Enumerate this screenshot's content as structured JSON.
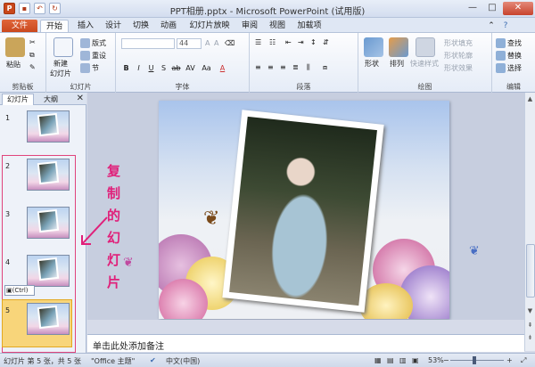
{
  "window": {
    "title": "PPT相册.pptx - Microsoft PowerPoint (试用版)",
    "app_icon": "P",
    "min": "—",
    "max": "□",
    "close": "✕"
  },
  "tabs": [
    "文件",
    "开始",
    "插入",
    "设计",
    "切换",
    "动画",
    "幻灯片放映",
    "审阅",
    "视图",
    "加载项"
  ],
  "ribbon": {
    "clipboard": {
      "label": "剪贴板",
      "paste": "粘贴"
    },
    "slides": {
      "label": "幻灯片",
      "new_slide": "新建",
      "new_slide2": "幻灯片",
      "layout": "版式",
      "reset": "重设",
      "section": "节"
    },
    "font": {
      "label": "字体",
      "size": "44"
    },
    "paragraph": {
      "label": "段落"
    },
    "drawing": {
      "label": "绘图",
      "shapes": "形状",
      "arrange": "排列",
      "quick_styles": "快速样式",
      "fill": "形状填充",
      "outline": "形状轮廓",
      "effects": "形状效果"
    },
    "editing": {
      "label": "编辑",
      "find": "查找",
      "replace": "替换",
      "select": "选择"
    }
  },
  "pane": {
    "tab_slides": "幻灯片",
    "tab_outline": "大纲",
    "close": "✕",
    "paste_options": "(Ctrl)",
    "slides": [
      {
        "num": "1"
      },
      {
        "num": "2"
      },
      {
        "num": "3"
      },
      {
        "num": "4"
      },
      {
        "num": "5"
      }
    ]
  },
  "annotation": [
    "复",
    "制",
    "的",
    "幻",
    "灯",
    "片"
  ],
  "notes": {
    "placeholder": "单击此处添加备注"
  },
  "status": {
    "slide_info": "幻灯片 第 5 张，共 5 张",
    "theme": "\"Office 主题\"",
    "language": "中文(中国)",
    "zoom": "53%"
  }
}
